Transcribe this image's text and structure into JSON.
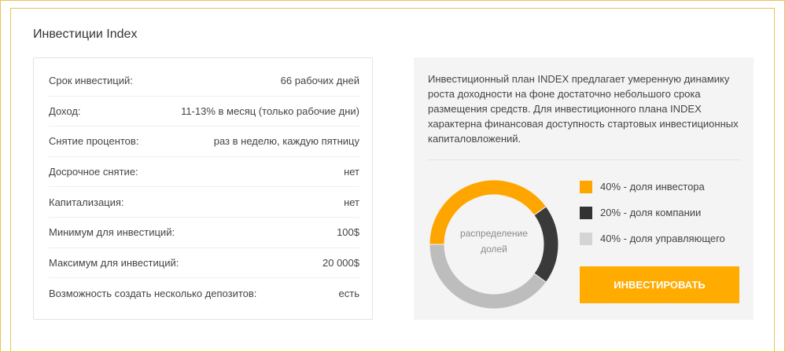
{
  "title": "Инвестиции Index",
  "params": [
    {
      "label": "Срок инвестиций:",
      "value": "66 рабочих дней"
    },
    {
      "label": "Доход:",
      "value": "11-13% в месяц (только рабочие дни)"
    },
    {
      "label": "Снятие процентов:",
      "value": "раз в неделю, каждую пятницу"
    },
    {
      "label": "Досрочное снятие:",
      "value": "нет"
    },
    {
      "label": "Капитализация:",
      "value": "нет"
    },
    {
      "label": "Минимум для инвестиций:",
      "value": "100$"
    },
    {
      "label": "Максимум для инвестиций:",
      "value": "20 000$"
    },
    {
      "label": "Возможность создать несколько депозитов:",
      "value": "есть"
    }
  ],
  "description": "Инвестиционный план INDEX предлагает умеренную динамику роста доходности на фоне достаточно небольшого срока размещения средств. Для инвестиционного плана INDEX характерна финансовая доступность стартовых инвестиционных капиталовложений.",
  "donut": {
    "label_line1": "распределение",
    "label_line2": "долей"
  },
  "chart_data": {
    "type": "pie",
    "categories": [
      "доля инвестора",
      "доля компании",
      "доля управляющего"
    ],
    "values": [
      40,
      20,
      40
    ],
    "colors": [
      "#ffa500",
      "#3a3a3a",
      "#bdbdbd"
    ]
  },
  "legend": [
    {
      "label": "40% - доля инвестора",
      "color": "#ffa500"
    },
    {
      "label": "20% - доля компании",
      "color": "#333333"
    },
    {
      "label": "40% - доля управляющего",
      "color": "#d4d4d4"
    }
  ],
  "invest_button": "ИНВЕСТИРОВАТЬ"
}
